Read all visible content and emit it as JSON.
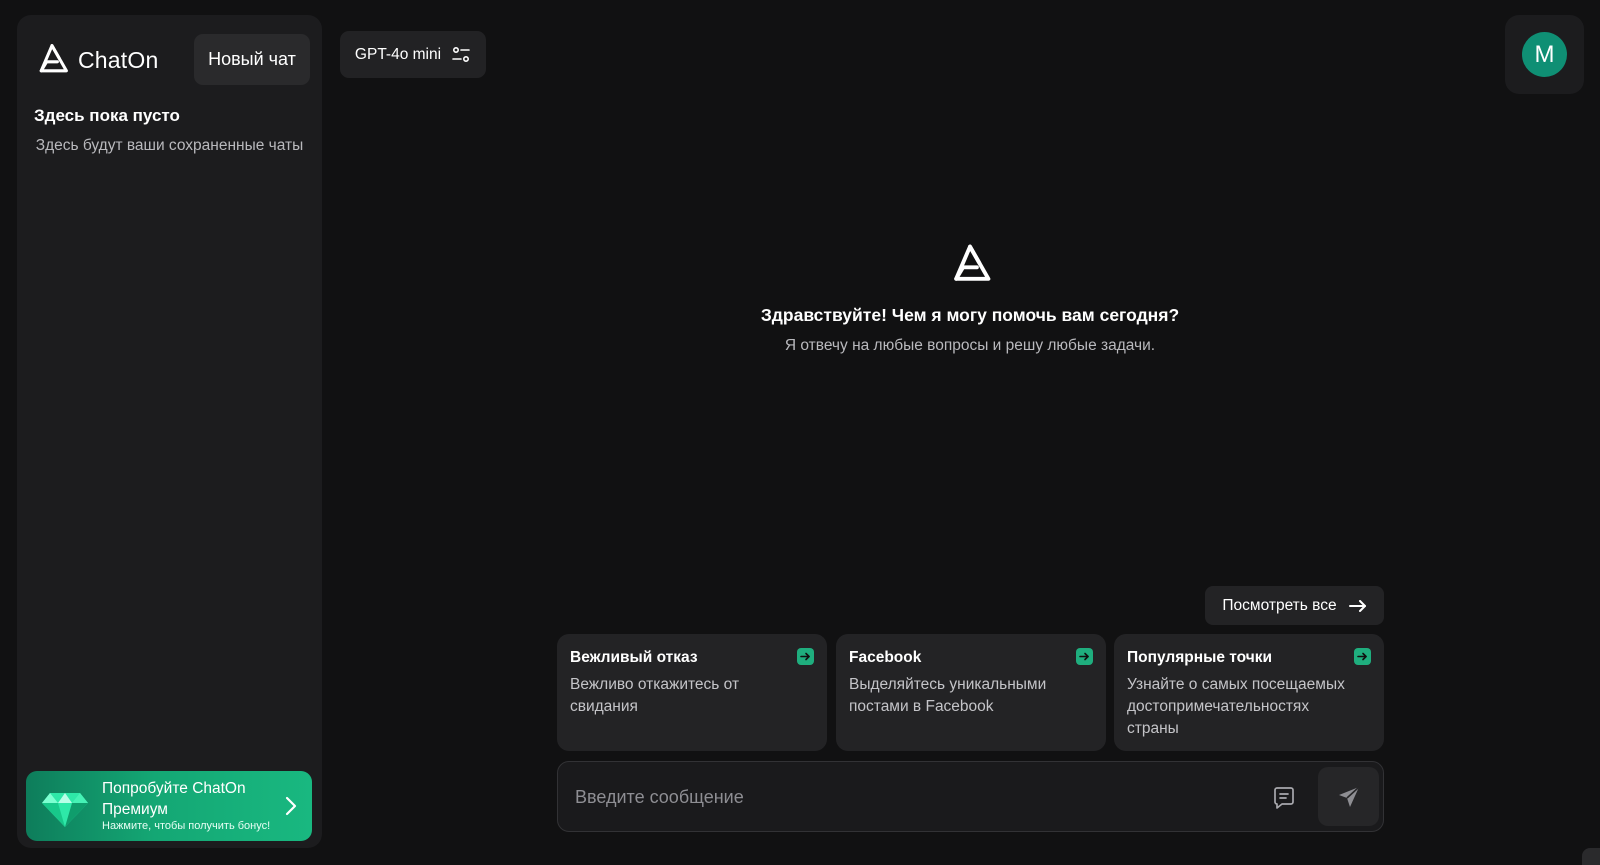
{
  "sidebar": {
    "brand_name": "ChatOn",
    "new_chat_label": "Новый чат",
    "empty_title": "Здесь пока пусто",
    "empty_subtitle": "Здесь будут ваши сохраненные чаты",
    "premium": {
      "title": "Попробуйте ChatOn Премиум",
      "subtitle": "Нажмите, чтобы получить бонус!"
    }
  },
  "header": {
    "model_label": "GPT-4o mini",
    "avatar_initial": "M"
  },
  "hero": {
    "title": "Здравствуйте! Чем я могу помочь вам сегодня?",
    "subtitle": "Я отвечу на любые вопросы и решу любые задачи."
  },
  "suggestions": {
    "see_all_label": "Посмотреть все",
    "cards": [
      {
        "title": "Вежливый отказ",
        "description": "Вежливо откажитесь от свидания"
      },
      {
        "title": "Facebook",
        "description": "Выделяйтесь уникальными постами в Facebook"
      },
      {
        "title": "Популярные точки",
        "description": "Узнайте о самых посещаемых достопримечательностях страны"
      }
    ]
  },
  "composer": {
    "placeholder": "Введите сообщение",
    "value": ""
  },
  "colors": {
    "background": "#111112",
    "panel": "#1c1c1e",
    "accent": "#1fae7e",
    "avatar": "#0f8f74"
  },
  "icons": {
    "logo": "chaton-logo-icon",
    "model_settings": "sliders-icon",
    "see_all": "arrow-right-icon",
    "card_action": "arrow-right-square-icon",
    "prompt_library": "prompt-list-icon",
    "send": "paper-plane-icon",
    "premium": "diamond-icon",
    "premium_go": "chevron-right-icon"
  }
}
